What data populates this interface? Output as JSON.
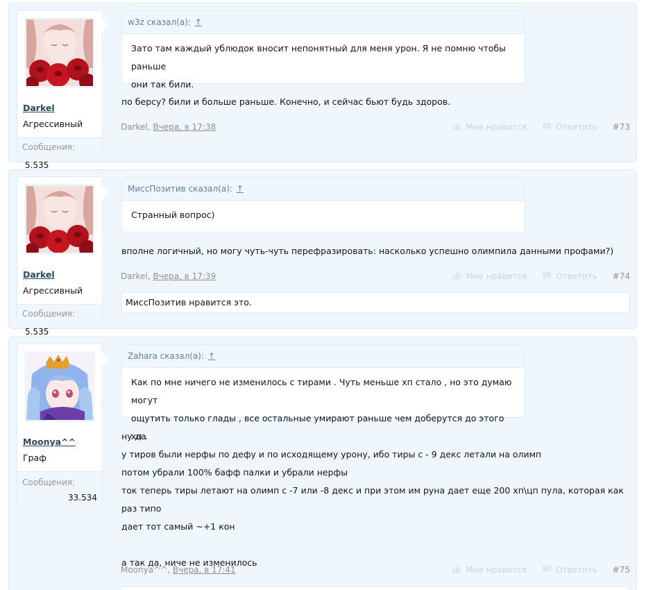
{
  "posts": [
    {
      "user": {
        "name": "Darkel",
        "title": "Агрессивный",
        "messages_label": "Сообщения:",
        "messages_count": "5.535"
      },
      "quote": {
        "author": "w3z",
        "said": "сказал(а):",
        "arrow": "↑",
        "lines": [
          "Зато там каждый ублюдок вносит непонятный для меня урон. Я не помню чтобы раньше",
          "они так били."
        ]
      },
      "lines": [
        "по берсу? били и больше раньше. Конечно, и сейчас бьют будь здоров."
      ],
      "author": "Darkel,",
      "date": "Вчера, в 17:38",
      "like_label": "Мне нравится",
      "reply_label": "Ответить",
      "permalink": "#73"
    },
    {
      "user": {
        "name": "Darkel",
        "title": "Агрессивный",
        "messages_label": "Сообщения:",
        "messages_count": "5.535"
      },
      "quote": {
        "author": "МиссПозитив",
        "said": "сказал(а):",
        "arrow": "↑",
        "lines": [
          "Странный вопрос)"
        ]
      },
      "lines": [
        "вполне логичный, но могу чуть-чуть перефразировать: насколько успешно олимпила данными профами?)"
      ],
      "author": "Darkel,",
      "date": "Вчера, в 17:39",
      "like_label": "Мне нравится",
      "reply_label": "Ответить",
      "permalink": "#74",
      "likes_text": "МиссПозитив нравится это."
    },
    {
      "user": {
        "name": "Moonya^^",
        "title": "Граф",
        "messages_label": "Сообщения:",
        "messages_count": "33.534"
      },
      "quote": {
        "author": "Zahara",
        "said": "сказал(а):",
        "arrow": "↑",
        "lines": [
          "Как по мне ничего не изменилось с тирами . Чуть меньше хп стало , но это думаю могут",
          "ощутить только глады , все остальные умирают раньше чем доберутся до этого хп ."
        ]
      },
      "lines": [
        "ну да",
        "у тиров были нерфы по дефу и по исходящему урону, ибо тиры с - 9 декс летали на олимп",
        "потом убрали 100% бафф палки и убрали нерфы",
        "ток теперь тиры летают на олимп с -7 или -8 декс и при этом им руна дает еще 200 хп\\цп пула, которая как раз типо",
        "дает тот самый ~+1 кон",
        "",
        "а так да, ниче не изменилось"
      ],
      "author": "Moonya^^,",
      "date": "Вчера, в 17:41",
      "like_label": "Мне нравится",
      "reply_label": "Ответить",
      "permalink": "#75"
    }
  ],
  "icons": {
    "like": "thumbs-up-icon",
    "reply": "speech-bubble-icon"
  },
  "colors": {
    "post_bg": "#f0f7fc",
    "border": "#d7edfc",
    "username": "#2b485c",
    "quote_author": "#5e7ea4",
    "muted": "#8f8f8f",
    "action": "#c4d4e4"
  }
}
